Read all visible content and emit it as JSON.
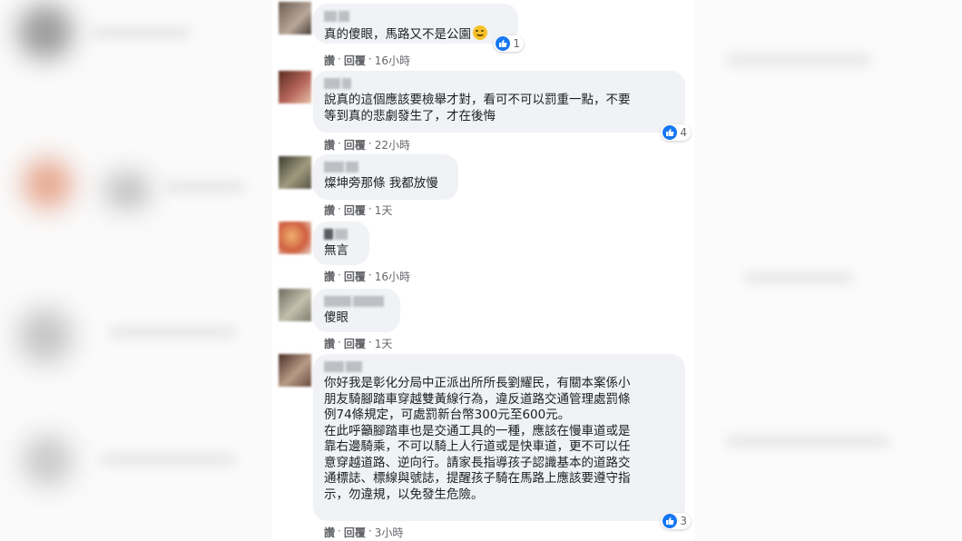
{
  "actions": {
    "like": "讚",
    "reply": "回覆",
    "sep": "·"
  },
  "comments": [
    {
      "text": "真的傻眼，馬路又不是公園",
      "time": "16小時",
      "reactions": "1",
      "emoji": "smiling-face"
    },
    {
      "text": "說真的這個應該要檢舉才對，看可不可以罰重一點，不要\n等到真的悲劇發生了，才在後悔",
      "time": "22小時",
      "reactions": "4"
    },
    {
      "text": "燦坤旁那條 我都放慢",
      "time": "1天"
    },
    {
      "text": "無言",
      "time": "16小時"
    },
    {
      "text": "傻眼",
      "time": "1天"
    },
    {
      "text": "你好我是彰化分局中正派出所所長劉耀民，有關本案係小\n朋友騎腳踏車穿越雙黃線行為，違反道路交通管理處罰條\n例74條規定，可處罰新台幣300元至600元。\n在此呼籲腳踏車也是交通工具的一種，應該在慢車道或是\n靠右邊騎乘，不可以騎上人行道或是快車道，更不可以任\n意穿越道路、逆向行。請家長指導孩子認識基本的道路交\n通標誌、標線與號誌，提醒孩子騎在馬路上應該要遵守指\n示，勿違規，以免發生危險。",
      "time": "3小時",
      "reactions": "3"
    }
  ],
  "colors": {
    "bubble": "#f0f2f5",
    "like_blue": "#1877f2",
    "meta_gray": "#65676b",
    "text": "#1c1e21"
  }
}
